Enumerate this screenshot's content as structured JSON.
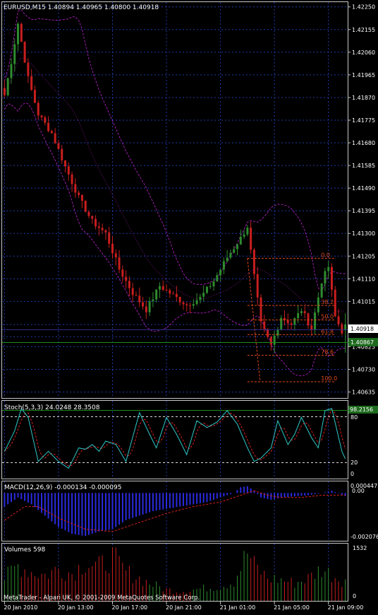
{
  "colors": {
    "background": "#000000",
    "bull": "#2e8b2e",
    "bear": "#c81e1e",
    "grid": "#1f3aa8",
    "band": "#a01eb0",
    "fib": "#e04a1c",
    "price_line": "#2e2e8a",
    "cursor_line": "#1e8c1e",
    "price_box": "#1e6a1e",
    "stoch_main": "#30c8c8",
    "stoch_signal": "#d82020",
    "macd_hist": "#2a2ae0",
    "macd_signal": "#d82020",
    "vol_bull": "#2e8b2e",
    "vol_bear": "#c81e1e",
    "text": "#ffffff",
    "level_line": "#dddddd"
  },
  "main": {
    "title": "EURUSD,M15  1.40894 1.40965 1.40800 1.40918",
    "price_ticks": [
      "1.42250",
      "1.42155",
      "1.42060",
      "1.41965",
      "1.41870",
      "1.41775",
      "1.41680",
      "1.41585",
      "1.41490",
      "1.41395",
      "1.41300",
      "1.41205",
      "1.41110",
      "1.41015",
      "1.40918",
      "1.40867",
      "1.40825",
      "1.40730",
      "1.40635"
    ],
    "current_price_label": "1.40918",
    "cursor_price_label": "1.40867",
    "fib_labels": [
      "0.0",
      "38.2",
      "50.0",
      "61.8",
      "78.6",
      "100.0"
    ]
  },
  "stoch": {
    "title": "Stoch(5,3,3) 24.0248 28.3508",
    "ticks": [
      "80",
      "20",
      "0"
    ],
    "cursor_value_label": "98.2156"
  },
  "macd": {
    "title": "MACD(12,26,9) -0.000134 -0.000095",
    "ticks": [
      "0.000447",
      "0.00",
      "-0.002076"
    ]
  },
  "volumes": {
    "title": "Volumes 598",
    "ticks": [
      "1532",
      "0"
    ]
  },
  "footer": {
    "copyright": "MetaTrader - Alpari UK, © 2001-2009 MetaQuotes Software Corp.",
    "time_labels": [
      "20 Jan 2010",
      "20 Jan 13:00",
      "20 Jan 17:00",
      "20 Jan 21:00",
      "21 Jan 01:00",
      "21 Jan 05:00",
      "21 Jan 09:00"
    ]
  },
  "chart_data": {
    "type": "candlestick",
    "symbol": "EURUSD",
    "timeframe": "M15",
    "last_bar": {
      "open": 1.40894,
      "high": 1.40965,
      "low": 1.408,
      "close": 1.40918
    },
    "ylim": [
      1.4061,
      1.4227
    ],
    "close_path": [
      {
        "bar": 0,
        "price": 1.4188
      },
      {
        "bar": 2,
        "price": 1.4202
      },
      {
        "bar": 4,
        "price": 1.4218
      },
      {
        "bar": 7,
        "price": 1.4195
      },
      {
        "bar": 10,
        "price": 1.418
      },
      {
        "bar": 14,
        "price": 1.4172
      },
      {
        "bar": 18,
        "price": 1.4158
      },
      {
        "bar": 22,
        "price": 1.4145
      },
      {
        "bar": 26,
        "price": 1.4135
      },
      {
        "bar": 30,
        "price": 1.413
      },
      {
        "bar": 34,
        "price": 1.4115
      },
      {
        "bar": 38,
        "price": 1.4105
      },
      {
        "bar": 42,
        "price": 1.4098
      },
      {
        "bar": 46,
        "price": 1.4108
      },
      {
        "bar": 50,
        "price": 1.4104
      },
      {
        "bar": 54,
        "price": 1.41
      },
      {
        "bar": 58,
        "price": 1.4103
      },
      {
        "bar": 62,
        "price": 1.411
      },
      {
        "bar": 66,
        "price": 1.412
      },
      {
        "bar": 70,
        "price": 1.4128
      },
      {
        "bar": 72,
        "price": 1.4133
      },
      {
        "bar": 74,
        "price": 1.4112
      },
      {
        "bar": 76,
        "price": 1.4092
      },
      {
        "bar": 79,
        "price": 1.4083
      },
      {
        "bar": 82,
        "price": 1.4095
      },
      {
        "bar": 85,
        "price": 1.4092
      },
      {
        "bar": 88,
        "price": 1.4098
      },
      {
        "bar": 91,
        "price": 1.409
      },
      {
        "bar": 94,
        "price": 1.411
      },
      {
        "bar": 96,
        "price": 1.4116
      },
      {
        "bar": 98,
        "price": 1.4095
      },
      {
        "bar": 100,
        "price": 1.4089
      },
      {
        "bar": 101,
        "price": 1.40918
      }
    ],
    "fibonacci": {
      "high": 1.41196,
      "low": 1.40678,
      "levels": [
        0.0,
        38.2,
        50.0,
        61.8,
        78.6,
        100.0
      ]
    },
    "stochastic": {
      "k": 5,
      "d": 3,
      "slowing": 3,
      "main": 24.0248,
      "signal": 28.3508,
      "levels": [
        80,
        20
      ],
      "main_path": [
        {
          "bar": 0,
          "value": 35
        },
        {
          "bar": 3,
          "value": 65
        },
        {
          "bar": 5,
          "value": 98
        },
        {
          "bar": 7,
          "value": 85
        },
        {
          "bar": 10,
          "value": 20
        },
        {
          "bar": 13,
          "value": 35
        },
        {
          "bar": 16,
          "value": 20
        },
        {
          "bar": 19,
          "value": 10
        },
        {
          "bar": 22,
          "value": 40
        },
        {
          "bar": 24,
          "value": 38
        },
        {
          "bar": 26,
          "value": 45
        },
        {
          "bar": 28,
          "value": 35
        },
        {
          "bar": 30,
          "value": 50
        },
        {
          "bar": 33,
          "value": 45
        },
        {
          "bar": 36,
          "value": 20
        },
        {
          "bar": 40,
          "value": 92
        },
        {
          "bar": 43,
          "value": 60
        },
        {
          "bar": 45,
          "value": 40
        },
        {
          "bar": 48,
          "value": 85
        },
        {
          "bar": 51,
          "value": 60
        },
        {
          "bar": 54,
          "value": 30
        },
        {
          "bar": 57,
          "value": 80
        },
        {
          "bar": 60,
          "value": 70
        },
        {
          "bar": 63,
          "value": 78
        },
        {
          "bar": 66,
          "value": 95
        },
        {
          "bar": 69,
          "value": 75
        },
        {
          "bar": 72,
          "value": 40
        },
        {
          "bar": 74,
          "value": 20
        },
        {
          "bar": 76,
          "value": 25
        },
        {
          "bar": 79,
          "value": 40
        },
        {
          "bar": 81,
          "value": 80
        },
        {
          "bar": 84,
          "value": 45
        },
        {
          "bar": 86,
          "value": 60
        },
        {
          "bar": 88,
          "value": 85
        },
        {
          "bar": 91,
          "value": 55
        },
        {
          "bar": 93,
          "value": 40
        },
        {
          "bar": 95,
          "value": 95
        },
        {
          "bar": 97,
          "value": 98
        },
        {
          "bar": 100,
          "value": 35
        },
        {
          "bar": 101,
          "value": 24
        }
      ]
    },
    "macd": {
      "fast": 12,
      "slow": 26,
      "signal_period": 9,
      "main": -0.000134,
      "signal": -9.5e-05,
      "ylim": [
        -0.002076,
        0.000447
      ],
      "hist_path": [
        {
          "bar": 0,
          "value": -0.0006
        },
        {
          "bar": 4,
          "value": -0.0002
        },
        {
          "bar": 8,
          "value": -0.0005
        },
        {
          "bar": 12,
          "value": -0.001
        },
        {
          "bar": 16,
          "value": -0.0015
        },
        {
          "bar": 20,
          "value": -0.0018
        },
        {
          "bar": 24,
          "value": -0.0019
        },
        {
          "bar": 28,
          "value": -0.0017
        },
        {
          "bar": 32,
          "value": -0.0016
        },
        {
          "bar": 36,
          "value": -0.0012
        },
        {
          "bar": 40,
          "value": -0.001
        },
        {
          "bar": 44,
          "value": -0.0008
        },
        {
          "bar": 48,
          "value": -0.0007
        },
        {
          "bar": 52,
          "value": -0.0006
        },
        {
          "bar": 56,
          "value": -0.0005
        },
        {
          "bar": 60,
          "value": -0.0004
        },
        {
          "bar": 64,
          "value": -0.0002
        },
        {
          "bar": 68,
          "value": 0.0
        },
        {
          "bar": 70,
          "value": 0.00025
        },
        {
          "bar": 72,
          "value": 0.0003
        },
        {
          "bar": 74,
          "value": 0.0001
        },
        {
          "bar": 76,
          "value": -0.0002
        },
        {
          "bar": 79,
          "value": -0.0003
        },
        {
          "bar": 82,
          "value": -0.0002
        },
        {
          "bar": 86,
          "value": -0.00015
        },
        {
          "bar": 90,
          "value": -0.0001
        },
        {
          "bar": 94,
          "value": 0.0
        },
        {
          "bar": 97,
          "value": 0.0001
        },
        {
          "bar": 101,
          "value": -0.000134
        }
      ],
      "signal_path": [
        {
          "bar": 0,
          "value": -0.0012
        },
        {
          "bar": 6,
          "value": -0.0006
        },
        {
          "bar": 10,
          "value": -0.0006
        },
        {
          "bar": 16,
          "value": -0.0011
        },
        {
          "bar": 24,
          "value": -0.0016
        },
        {
          "bar": 32,
          "value": -0.0017
        },
        {
          "bar": 40,
          "value": -0.0013
        },
        {
          "bar": 48,
          "value": -0.0009
        },
        {
          "bar": 56,
          "value": -0.0006
        },
        {
          "bar": 64,
          "value": -0.0004
        },
        {
          "bar": 70,
          "value": -0.0001
        },
        {
          "bar": 74,
          "value": 0.0001
        },
        {
          "bar": 78,
          "value": -0.0001
        },
        {
          "bar": 82,
          "value": -0.0002
        },
        {
          "bar": 88,
          "value": -0.0002
        },
        {
          "bar": 94,
          "value": -0.0001
        },
        {
          "bar": 101,
          "value": -9.5e-05
        }
      ]
    },
    "volume": {
      "last": 598,
      "ymax": 1532,
      "path": [
        {
          "bar": 0,
          "value": 700
        },
        {
          "bar": 4,
          "value": 1100
        },
        {
          "bar": 8,
          "value": 900
        },
        {
          "bar": 12,
          "value": 800
        },
        {
          "bar": 16,
          "value": 1000
        },
        {
          "bar": 20,
          "value": 850
        },
        {
          "bar": 24,
          "value": 1200
        },
        {
          "bar": 28,
          "value": 1050
        },
        {
          "bar": 32,
          "value": 1350
        },
        {
          "bar": 36,
          "value": 900
        },
        {
          "bar": 40,
          "value": 700
        },
        {
          "bar": 44,
          "value": 500
        },
        {
          "bar": 48,
          "value": 350
        },
        {
          "bar": 52,
          "value": 300
        },
        {
          "bar": 56,
          "value": 350
        },
        {
          "bar": 60,
          "value": 400
        },
        {
          "bar": 64,
          "value": 450
        },
        {
          "bar": 68,
          "value": 600
        },
        {
          "bar": 72,
          "value": 1500
        },
        {
          "bar": 74,
          "value": 1100
        },
        {
          "bar": 78,
          "value": 700
        },
        {
          "bar": 82,
          "value": 650
        },
        {
          "bar": 86,
          "value": 550
        },
        {
          "bar": 90,
          "value": 700
        },
        {
          "bar": 94,
          "value": 1000
        },
        {
          "bar": 98,
          "value": 750
        },
        {
          "bar": 101,
          "value": 598
        }
      ]
    }
  }
}
